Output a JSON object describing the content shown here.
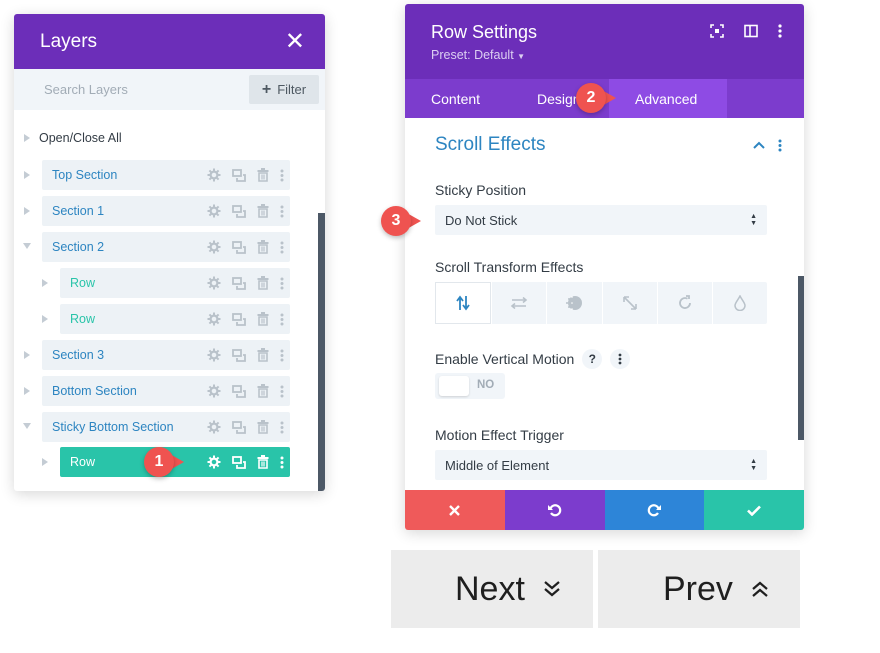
{
  "layers": {
    "title": "Layers",
    "search_placeholder": "Search Layers",
    "filter_label": "Filter",
    "open_close_all": "Open/Close All",
    "items": [
      {
        "label": "Top Section",
        "type": "section"
      },
      {
        "label": "Section 1",
        "type": "section"
      },
      {
        "label": "Section 2",
        "type": "section"
      },
      {
        "label": "Row",
        "type": "row"
      },
      {
        "label": "Row",
        "type": "row"
      },
      {
        "label": "Section 3",
        "type": "section"
      },
      {
        "label": "Bottom Section",
        "type": "section"
      },
      {
        "label": "Sticky Bottom Section",
        "type": "section"
      },
      {
        "label": "Row",
        "type": "row-active"
      }
    ]
  },
  "settings": {
    "title": "Row Settings",
    "preset": "Preset: Default",
    "tabs": [
      "Content",
      "Design",
      "Advanced"
    ],
    "active_tab": "Advanced",
    "section_title": "Scroll Effects",
    "sticky_position_label": "Sticky Position",
    "sticky_position_value": "Do Not Stick",
    "scroll_transform_label": "Scroll Transform Effects",
    "vertical_motion_label": "Enable Vertical Motion",
    "vertical_motion_help": "?",
    "vertical_motion_toggle": "NO",
    "motion_trigger_label": "Motion Effect Trigger",
    "motion_trigger_value": "Middle of Element",
    "footer_colors": [
      "#ef5a5a",
      "#7c3ccd",
      "#2d85d8",
      "#29c4a9"
    ]
  },
  "callouts": [
    "1",
    "2",
    "3"
  ],
  "nav": {
    "next_label": "Next",
    "prev_label": "Prev"
  },
  "colors": {
    "header_purple": "#6c2eb9",
    "tab_purple": "#7c3ccd",
    "section_blue": "#2d85c1",
    "row_teal": "#29c4a9",
    "callout_red": "#ef5350"
  }
}
